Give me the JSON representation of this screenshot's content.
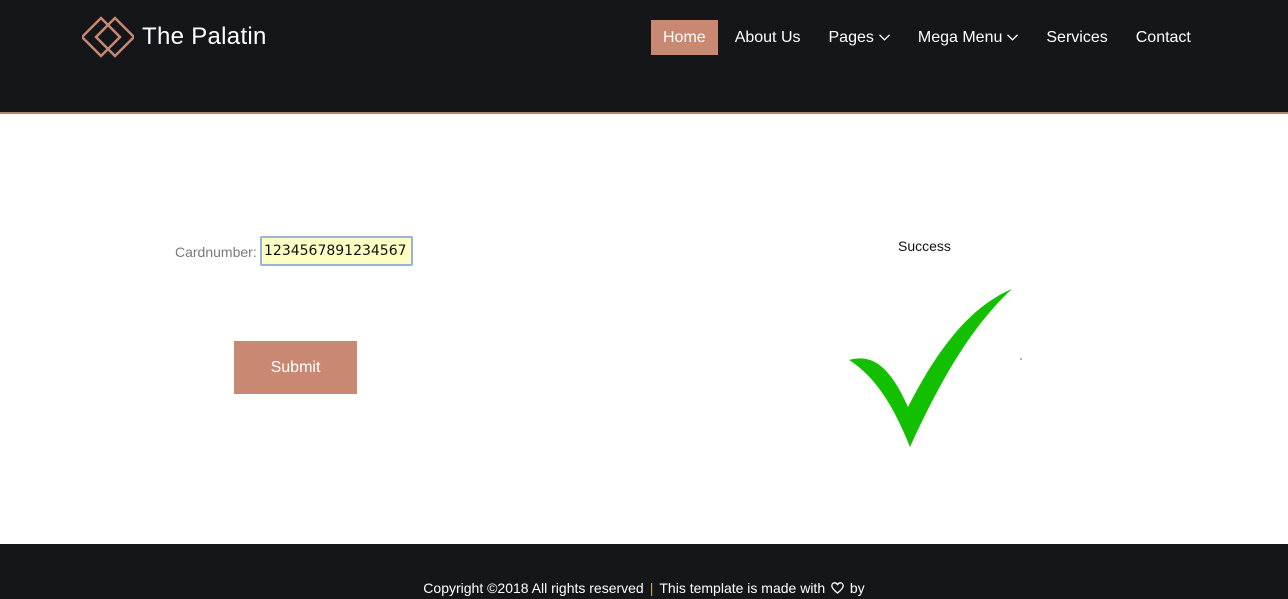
{
  "brand": {
    "name": "The Palatin",
    "logo_icon": "diamond-logo-icon",
    "accent_color": "#c98871"
  },
  "nav": {
    "items": [
      {
        "label": "Home",
        "active": true
      },
      {
        "label": "About Us"
      },
      {
        "label": "Pages",
        "has_dropdown": true
      },
      {
        "label": "Mega Menu",
        "has_dropdown": true
      },
      {
        "label": "Services"
      },
      {
        "label": "Contact"
      }
    ]
  },
  "form": {
    "card_label": "Cardnumber:",
    "card_value": "1234567891234567",
    "submit_label": "Submit"
  },
  "result": {
    "status_text": "Success",
    "icon": "check-mark-icon",
    "icon_color": "#12c000"
  },
  "footer": {
    "copyright": "Copyright ©2018 All rights reserved",
    "separator": "|",
    "made_with": "This template is made with",
    "by": "by"
  }
}
